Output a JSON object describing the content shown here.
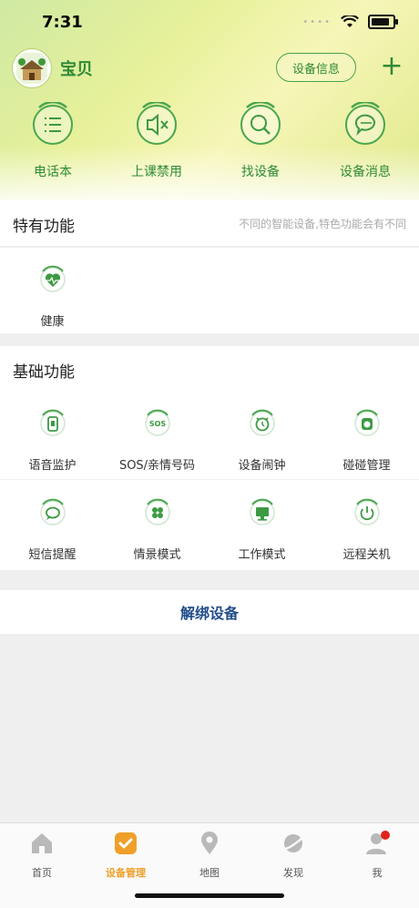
{
  "status_bar": {
    "time": "7:31",
    "battery_level": 0.85
  },
  "header": {
    "baby_name": "宝贝",
    "device_info_label": "设备信息",
    "add_label": "+",
    "quick_actions": [
      {
        "label": "电话本",
        "icon": "phonebook-list-icon"
      },
      {
        "label": "上课禁用",
        "icon": "mute-speaker-icon"
      },
      {
        "label": "找设备",
        "icon": "search-icon"
      },
      {
        "label": "设备消息",
        "icon": "message-bubble-icon"
      }
    ]
  },
  "special": {
    "title": "特有功能",
    "hint": "不同的智能设备,特色功能会有不同",
    "items": [
      {
        "label": "健康",
        "icon": "health-heart-icon"
      }
    ]
  },
  "basic": {
    "title": "基础功能",
    "items": [
      {
        "label": "语音监护",
        "icon": "voice-monitor-icon"
      },
      {
        "label": "SOS/亲情号码",
        "icon": "sos-icon",
        "icon_text": "SOS"
      },
      {
        "label": "设备闹钟",
        "icon": "alarm-clock-icon"
      },
      {
        "label": "碰碰管理",
        "icon": "bump-manage-icon"
      },
      {
        "label": "短信提醒",
        "icon": "sms-icon"
      },
      {
        "label": "情景模式",
        "icon": "scene-mode-icon"
      },
      {
        "label": "工作模式",
        "icon": "work-mode-icon"
      },
      {
        "label": "远程关机",
        "icon": "power-icon"
      }
    ]
  },
  "unbind_label": "解绑设备",
  "tabs": [
    {
      "label": "首页",
      "icon": "home-icon",
      "active": false
    },
    {
      "label": "设备管理",
      "icon": "device-manage-icon",
      "active": true
    },
    {
      "label": "地图",
      "icon": "map-pin-icon",
      "active": false
    },
    {
      "label": "发现",
      "icon": "discover-planet-icon",
      "active": false
    },
    {
      "label": "我",
      "icon": "user-icon",
      "active": false,
      "badge": true
    }
  ],
  "colors": {
    "accent_green": "#2f8b35",
    "tab_active": "#f0a02a",
    "unbind_text": "#214c8a",
    "badge_red": "#e0231b"
  }
}
